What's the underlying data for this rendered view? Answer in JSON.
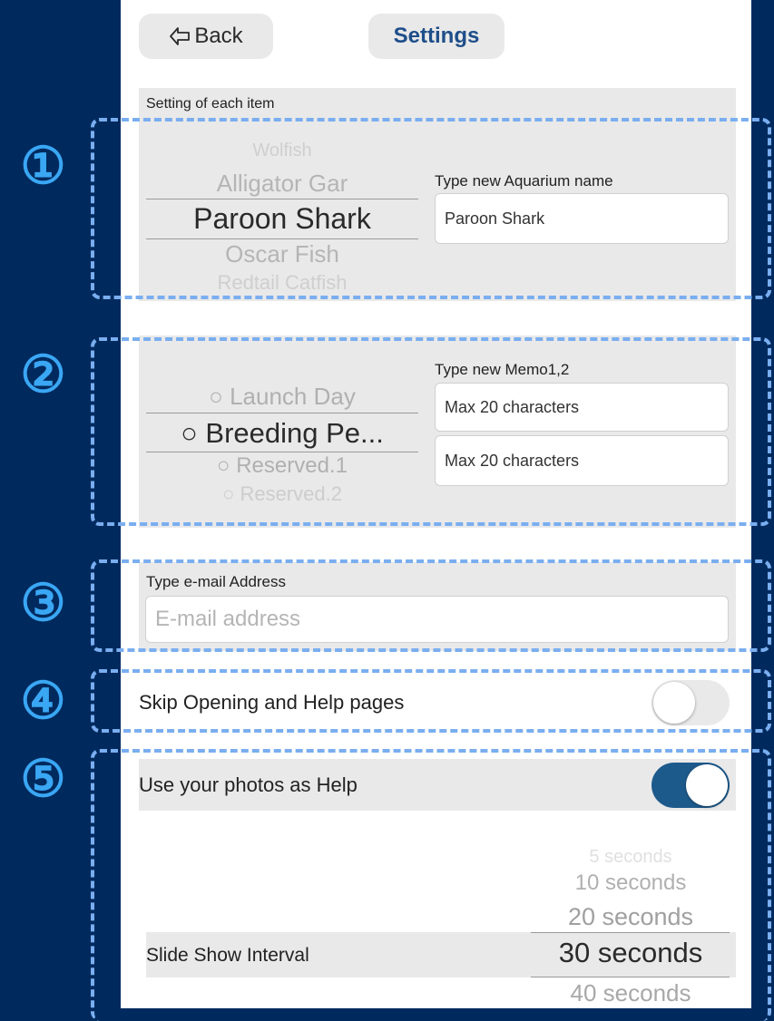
{
  "nav": {
    "back_label": "Back",
    "title": "Settings"
  },
  "item_section": {
    "header": "Setting of each item",
    "picker": [
      "Wolfish",
      "Alligator Gar",
      "Paroon Shark",
      "Oscar Fish",
      "Redtail Catfish"
    ],
    "name_label": "Type new Aquarium name",
    "name_value": "Paroon Shark"
  },
  "memo_section": {
    "picker": [
      "○ Launch Day",
      "○ Breeding Pe...",
      "○ Reserved.1",
      "○ Reserved.2"
    ],
    "memo_label": "Type new Memo1,2",
    "memo1_value": "Max 20 characters",
    "memo2_value": "Max 20 characters"
  },
  "email_section": {
    "label": "Type e-mail Address",
    "placeholder": "E-mail address"
  },
  "skip_row": {
    "label": "Skip Opening and Help pages",
    "enabled": false
  },
  "photos_row": {
    "label": "Use your photos as Help",
    "enabled": true,
    "accent": "#1d5a8c"
  },
  "slideshow": {
    "label": "Slide Show Interval",
    "options": [
      "5 seconds",
      "10 seconds",
      "20 seconds",
      "30 seconds",
      "40 seconds"
    ],
    "selected": "30 seconds"
  },
  "markers": [
    "①",
    "②",
    "③",
    "④",
    "⑤"
  ]
}
